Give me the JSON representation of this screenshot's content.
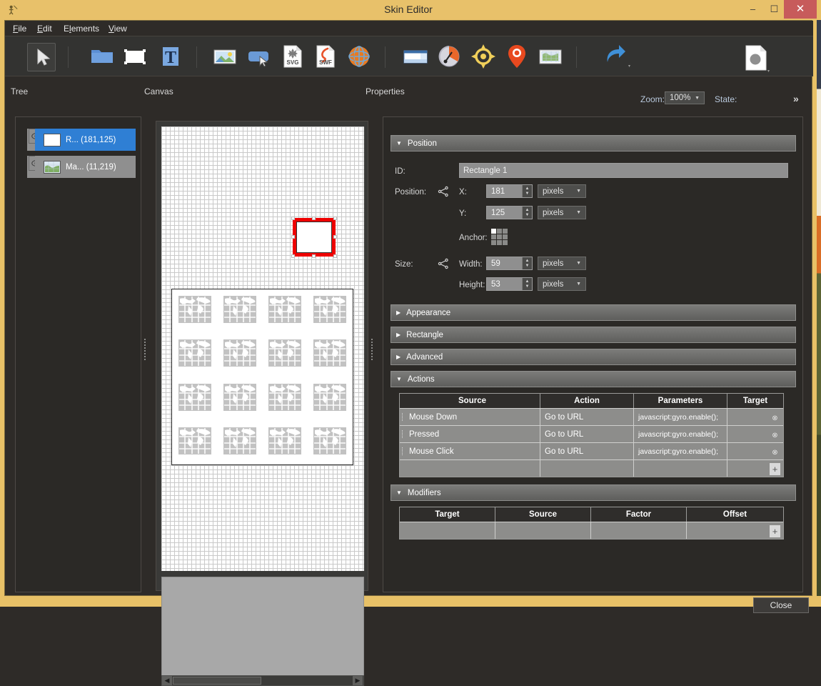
{
  "window": {
    "title": "Skin Editor",
    "app_icon": "app-icon",
    "minimize_label": "–",
    "maximize_label": "☐",
    "close_label": "✕"
  },
  "menu": {
    "items": [
      {
        "pre": "",
        "accel": "F",
        "post": "ile"
      },
      {
        "pre": "",
        "accel": "E",
        "post": "dit"
      },
      {
        "pre": "E",
        "accel": "l",
        "post": "ements"
      },
      {
        "pre": "",
        "accel": "V",
        "post": "iew"
      }
    ]
  },
  "toolbar": {
    "icons": [
      "cursor-select-icon",
      "folder-icon",
      "rectangle-icon",
      "text-icon",
      "image-icon",
      "button-icon",
      "svg-file-icon",
      "swf-file-icon",
      "globe-icon",
      "panel-icon",
      "gauge-icon",
      "compass-icon",
      "map-pin-icon",
      "map-image-icon"
    ],
    "undo_icon": "undo-icon",
    "zoom_label": "Zoom:",
    "zoom_value": "100%",
    "state_label": "State:",
    "state_icon": "state-shape-icon",
    "overflow_label": "»"
  },
  "panels": {
    "tree_label": "Tree",
    "canvas_label": "Canvas",
    "properties_label": "Properties"
  },
  "tree": {
    "items": [
      {
        "label": "R... (181,125)",
        "icon": "rectangle-thumb-icon",
        "selected": true,
        "visibility_icon": "eye-icon"
      },
      {
        "label": "Ma... (11,219)",
        "icon": "map-thumb-icon",
        "selected": false,
        "visibility_icon": "eye-icon"
      }
    ]
  },
  "canvas": {
    "selected_rect": {
      "color": "#ee0000"
    },
    "map_tiles_count": 16,
    "scroll_left_icon": "scroll-left-arrow-icon",
    "scroll_right_icon": "scroll-right-arrow-icon"
  },
  "properties": {
    "sections": [
      {
        "name": "Position",
        "expanded": true
      },
      {
        "name": "Appearance",
        "expanded": false
      },
      {
        "name": "Rectangle",
        "expanded": false
      },
      {
        "name": "Advanced",
        "expanded": false
      },
      {
        "name": "Actions",
        "expanded": true
      },
      {
        "name": "Modifiers",
        "expanded": true
      }
    ],
    "position": {
      "id_label": "ID:",
      "id_value": "Rectangle 1",
      "position_label": "Position:",
      "x_label": "X:",
      "x_value": "181",
      "x_unit": "pixels",
      "y_label": "Y:",
      "y_value": "125",
      "y_unit": "pixels",
      "anchor_label": "Anchor:",
      "anchor_selected": "top-left",
      "size_label": "Size:",
      "width_label": "Width:",
      "width_value": "59",
      "width_unit": "pixels",
      "height_label": "Height:",
      "height_value": "53",
      "height_unit": "pixels"
    },
    "actions": {
      "columns": [
        "Source",
        "Action",
        "Parameters",
        "Target"
      ],
      "rows": [
        {
          "source": "Mouse Down",
          "action": "Go to URL",
          "parameters": "javascript:gyro.enable();",
          "target": ""
        },
        {
          "source": "Pressed",
          "action": "Go to URL",
          "parameters": "javascript:gyro.enable();",
          "target": ""
        },
        {
          "source": "Mouse Click",
          "action": "Go to URL",
          "parameters": "javascript:gyro.enable();",
          "target": ""
        },
        {
          "source": "",
          "action": "",
          "parameters": "",
          "target": ""
        }
      ],
      "delete_icon": "⊗",
      "add_label": "+"
    },
    "modifiers": {
      "columns": [
        "Target",
        "Source",
        "Factor",
        "Offset"
      ],
      "rows": [
        {
          "target": "",
          "source": "",
          "factor": "",
          "offset": ""
        }
      ],
      "add_label": "+"
    }
  },
  "footer": {
    "close_label": "Close"
  },
  "colors": {
    "window_chrome": "#e8c167",
    "app_background": "#2e2b28",
    "selection_blue": "#2f7fd4",
    "selection_red": "#ee0000",
    "close_red": "#c75b5b"
  }
}
